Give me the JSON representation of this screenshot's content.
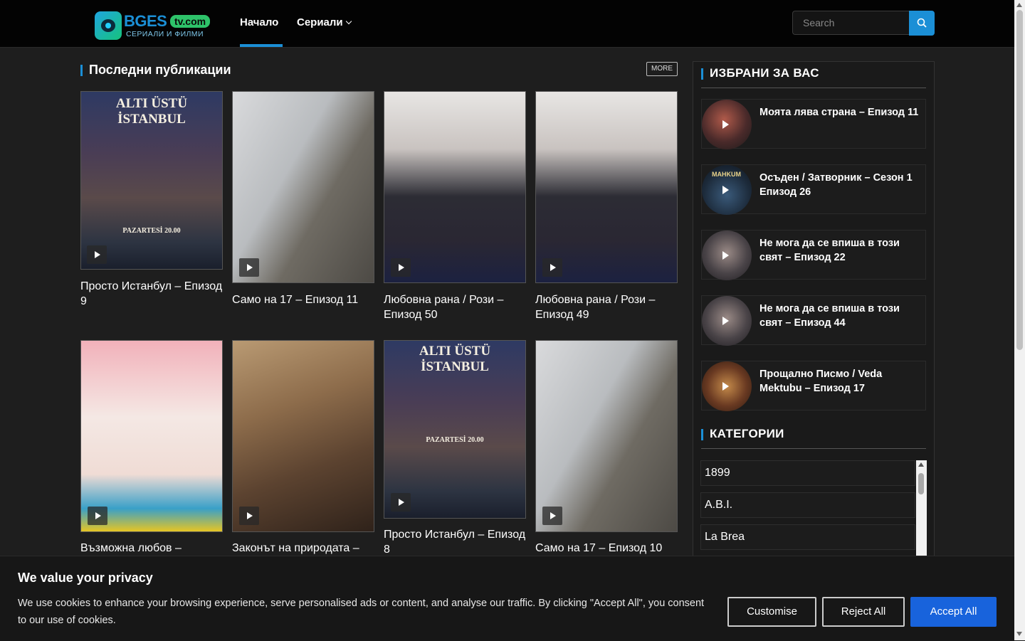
{
  "header": {
    "logo": {
      "main": "BGES",
      "badge": "tv.com",
      "subtitle": "СЕРИАЛИ И ФИЛМИ"
    },
    "nav": {
      "home": "Начало",
      "series": "Сериали"
    },
    "search": {
      "placeholder": "Search"
    }
  },
  "latest": {
    "title": "Последни публикации",
    "more": "MORE",
    "cards": [
      {
        "title": "Просто Истанбул – Епизод 9",
        "poster": "istanbul",
        "poster_text": "ALTI ÜSTÜ İSTANBUL",
        "poster_sub": "PAZARTESİ 20.00"
      },
      {
        "title": "Само на 17 – Епизод 11",
        "poster": "17"
      },
      {
        "title": "Любовна рана / Рози – Епизод 50",
        "poster": "rose"
      },
      {
        "title": "Любовна рана / Рози – Епизод 49",
        "poster": "rose"
      },
      {
        "title": "Възможна любов –",
        "poster": "love"
      },
      {
        "title": "Законът на природата –",
        "poster": "law"
      },
      {
        "title": "Просто Истанбул – Епизод 8",
        "poster": "istanbul",
        "poster_text": "ALTI ÜSTÜ İSTANBUL",
        "poster_sub": "PAZARTESİ 20.00"
      },
      {
        "title": "Само на 17 – Епизод 10",
        "poster": "17"
      }
    ]
  },
  "sidebar": {
    "featured_title": "ИЗБРАНИ ЗА ВАС",
    "featured": [
      {
        "title": "Моята лява страна – Епизод 11"
      },
      {
        "title": "Осъден / Затворник – Сезон 1 Епизод 26",
        "thumb_text": "MAHKUM"
      },
      {
        "title": "Не мога да се впиша в този свят – Епизод 22"
      },
      {
        "title": "Не мога да се впиша в този свят – Епизод 44"
      },
      {
        "title": "Прощално Писмо / Veda Mektubu – Епизод 17"
      }
    ],
    "categories_title": "КАТЕГОРИИ",
    "categories": [
      "1899",
      "A.B.I.",
      "La Brea"
    ]
  },
  "cookie": {
    "title": "We value your privacy",
    "text": "We use cookies to enhance your browsing experience, serve personalised ads or content, and analyse our traffic. By clicking \"Accept All\", you consent to our use of cookies.",
    "customise": "Customise",
    "reject": "Reject All",
    "accept": "Accept All"
  },
  "colors": {
    "accent": "#1b8fd6",
    "accept": "#1863dc",
    "background": "#1e1e1e"
  }
}
